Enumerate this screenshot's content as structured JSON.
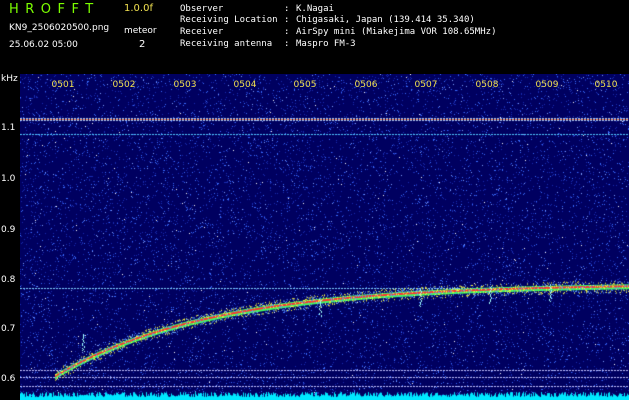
{
  "header": {
    "app_title": "HROFFT",
    "version": "1.0.0f",
    "filename": "KN9_2506020500.png",
    "meteor_label": "meteor",
    "meteor_count": "2",
    "datetime": "25.06.02 05:00"
  },
  "info": [
    {
      "label": "Observer",
      "value": "K.Nagai"
    },
    {
      "label": "Receiving Location",
      "value": "Chigasaki, Japan (139.414 35.340)"
    },
    {
      "label": "Receiver",
      "value": "AirSpy mini (Miakejima VOR 108.65MHz)"
    },
    {
      "label": "Receiving antenna",
      "value": "Maspro FM-3"
    }
  ],
  "separator": ":",
  "spectrogram": {
    "freq_unit": "kHz",
    "y_ticks": [
      "1.1",
      "1.0",
      "0.9",
      "0.8",
      "0.7",
      "0.6"
    ],
    "x_ticks": [
      "0501",
      "0502",
      "0503",
      "0504",
      "0505",
      "0506",
      "0507",
      "0508",
      "0509",
      "0510"
    ],
    "colors": {
      "background": "#000060",
      "noise": "#3a6cff",
      "trace": "#ff3030",
      "baseline": "#00e8ff"
    }
  }
}
